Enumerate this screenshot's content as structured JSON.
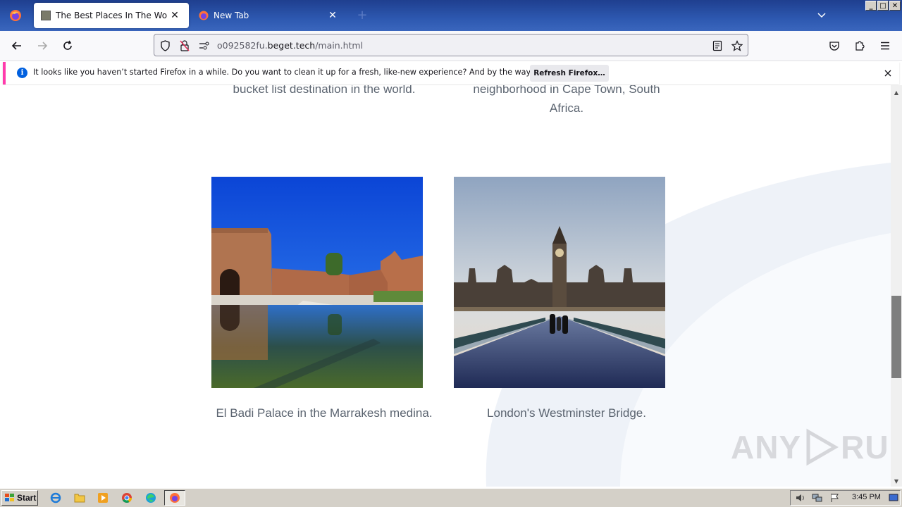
{
  "browser": {
    "tabs": [
      {
        "title": "The Best Places In The World",
        "active": true,
        "icon": "page-thumbnail-icon"
      },
      {
        "title": "New Tab",
        "active": false,
        "icon": "firefox-icon"
      }
    ],
    "new_tab_label": "+",
    "url": {
      "prefix": "o092582fu.",
      "host": "beget.tech",
      "path": "/main.html"
    },
    "window_controls": [
      "_",
      "□",
      "✕"
    ]
  },
  "notification": {
    "message": "It looks like you haven’t started Firefox in a while. Do you want to clean it up for a fresh, like-new experience? And by the way, welcome back!",
    "button_label": "Refresh Firefox…",
    "accent": "#ff3bac"
  },
  "page": {
    "top_captions": [
      {
        "lines": [
          "bucket list destination in the world."
        ]
      },
      {
        "lines": [
          "neighborhood in Cape Town, South",
          "Africa."
        ]
      }
    ],
    "cards": [
      {
        "caption": "El Badi Palace in the Marrakesh medina.",
        "image": "el-badi-palace-photo"
      },
      {
        "caption": "London's Westminster Bridge.",
        "image": "westminster-bridge-photo"
      }
    ]
  },
  "watermark": {
    "text": "ANY RUN"
  },
  "taskbar": {
    "start_label": "Start",
    "clock": "3:45 PM",
    "pinned": [
      "ie-icon",
      "folder-icon",
      "media-player-icon",
      "chrome-icon",
      "edge-icon",
      "firefox-icon"
    ]
  }
}
